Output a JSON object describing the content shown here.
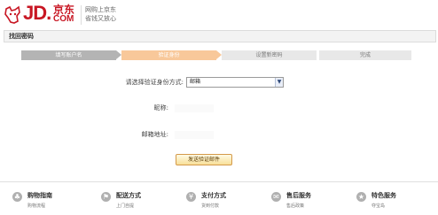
{
  "header": {
    "logo_jd": "JD.",
    "logo_cn": "京东",
    "logo_com": "COM",
    "slogan_line1": "网购上京东",
    "slogan_line2": "省钱又放心",
    "brand_color": "#c81623"
  },
  "page_title": "找回密码",
  "steps": [
    {
      "label": "填写账户名",
      "state": "done"
    },
    {
      "label": "验证身份",
      "state": "active"
    },
    {
      "label": "设置新密码",
      "state": "todo"
    },
    {
      "label": "完成",
      "state": "todo"
    }
  ],
  "form": {
    "method_label": "请选择验证身份方式:",
    "method_value": "邮箱",
    "nickname_label": "昵称:",
    "email_label": "邮箱地址:",
    "send_button": "发送验证邮件"
  },
  "footer": [
    {
      "title": "购物指南",
      "sub": "购物流程",
      "icon": "shopping-guide-icon",
      "glyph": "♣"
    },
    {
      "title": "配送方式",
      "sub": "上门自提",
      "icon": "delivery-icon",
      "glyph": "⚑"
    },
    {
      "title": "支付方式",
      "sub": "货到付款",
      "icon": "payment-icon",
      "glyph": "¥"
    },
    {
      "title": "售后服务",
      "sub": "售后政策",
      "icon": "after-sales-icon",
      "glyph": "✉"
    },
    {
      "title": "特色服务",
      "sub": "夺宝岛",
      "icon": "special-service-icon",
      "glyph": "★"
    }
  ]
}
